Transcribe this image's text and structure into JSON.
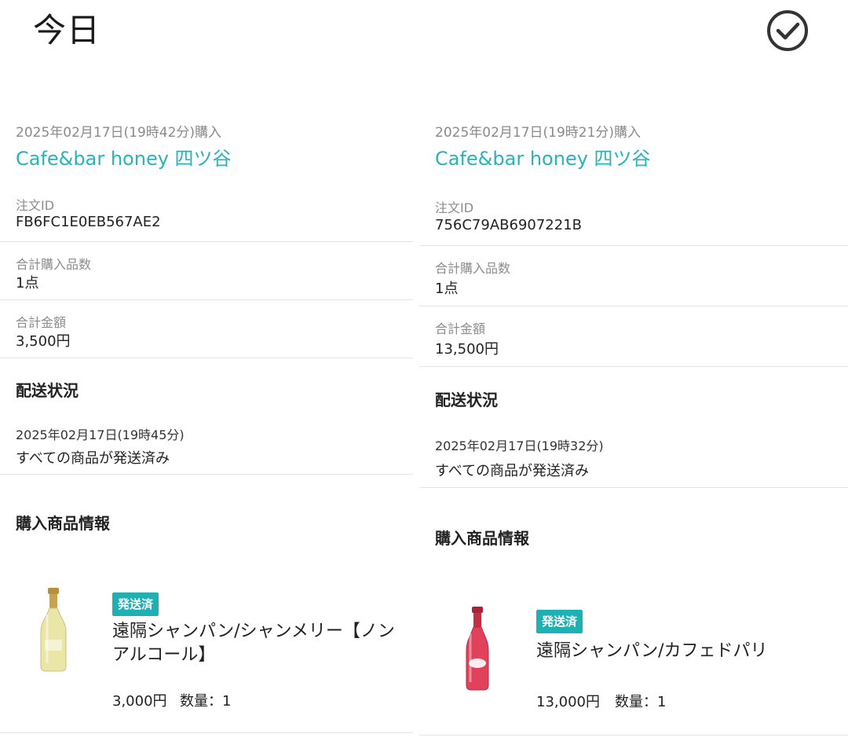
{
  "header": {
    "title": "今日"
  },
  "orders": [
    {
      "purchase_date": "2025年02月17日(19時42分)購入",
      "shop_name": "Cafe&bar honey 四ツ谷",
      "order_id_label": "注文ID",
      "order_id": "FB6FC1E0EB567AE2",
      "total_items_label": "合計購入品数",
      "total_items": "1点",
      "total_amount_label": "合計金額",
      "total_amount": "3,500円",
      "shipping_title": "配送状況",
      "shipping_date": "2025年02月17日(19時45分)",
      "shipping_status": "すべての商品が発送済み",
      "products_title": "購入商品情報",
      "product": {
        "badge": "発送済",
        "name": "遠隔シャンパン/シャンメリー【ノンアルコール】",
        "price": "3,000円",
        "quantity": "数量：1",
        "bottle_color": "#e9e6a8"
      }
    },
    {
      "purchase_date": "2025年02月17日(19時21分)購入",
      "shop_name": "Cafe&bar honey 四ツ谷",
      "order_id_label": "注文ID",
      "order_id": "756C79AB6907221B",
      "total_items_label": "合計購入品数",
      "total_items": "1点",
      "total_amount_label": "合計金額",
      "total_amount": "13,500円",
      "shipping_title": "配送状況",
      "shipping_date": "2025年02月17日(19時32分)",
      "shipping_status": "すべての商品が発送済み",
      "products_title": "購入商品情報",
      "product": {
        "badge": "発送済",
        "name": "遠隔シャンパン/カフェドパリ",
        "price": "13,000円",
        "quantity": "数量：1",
        "bottle_color": "#e0425c"
      }
    }
  ],
  "icons": {
    "done": "check-circle-icon"
  },
  "colors": {
    "accent": "#29b3b8",
    "badge": "#1fb0b4",
    "divider": "#e4e4e4"
  }
}
